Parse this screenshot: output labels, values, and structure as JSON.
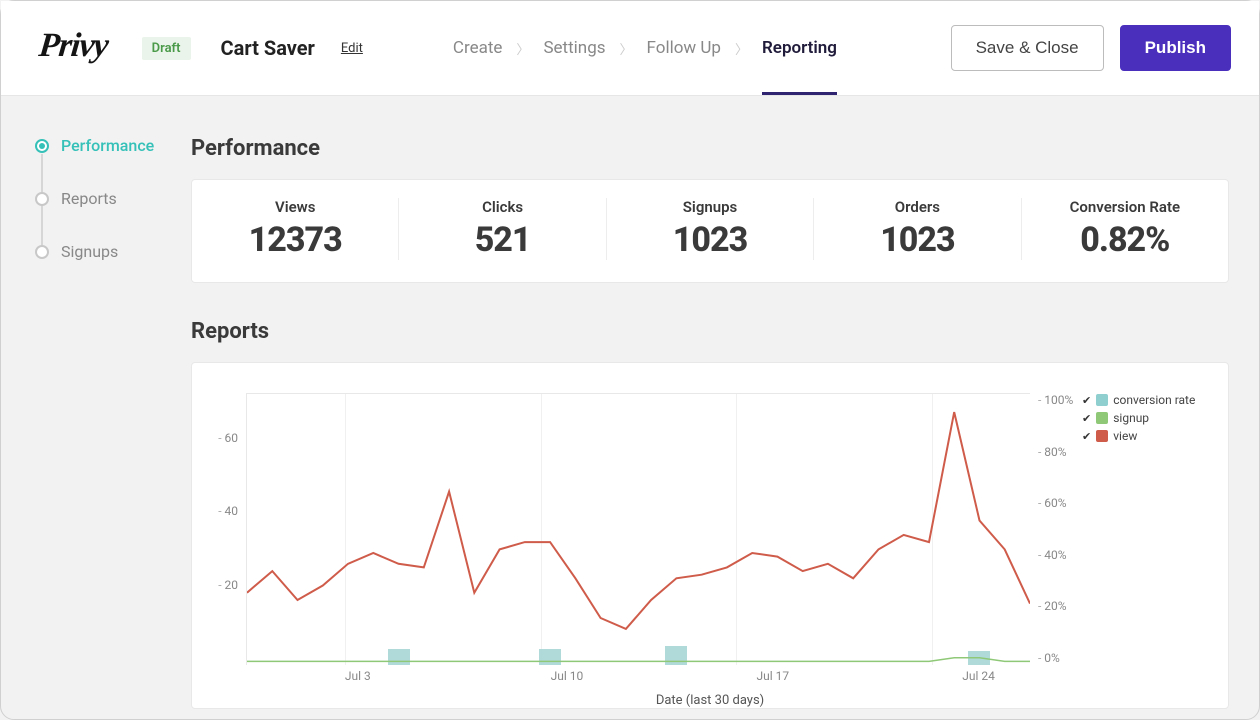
{
  "header": {
    "logo_text": "Privy",
    "status_badge": "Draft",
    "campaign_name": "Cart Saver",
    "edit_label": "Edit",
    "nav": [
      "Create",
      "Settings",
      "Follow Up",
      "Reporting"
    ],
    "active_nav_index": 3,
    "save_close_label": "Save & Close",
    "publish_label": "Publish"
  },
  "sidebar": {
    "items": [
      "Performance",
      "Reports",
      "Signups"
    ],
    "active_index": 0
  },
  "sections": {
    "performance_title": "Performance",
    "reports_title": "Reports"
  },
  "stats": [
    {
      "label": "Views",
      "value": "12373"
    },
    {
      "label": "Clicks",
      "value": "521"
    },
    {
      "label": "Signups",
      "value": "1023"
    },
    {
      "label": "Orders",
      "value": "1023"
    },
    {
      "label": "Conversion Rate",
      "value": "0.82%"
    }
  ],
  "chart_data": {
    "type": "line",
    "xlabel": "Date (last 30 days)",
    "x_ticks": [
      "",
      "Jul 3",
      "",
      "Jul 10",
      "",
      "Jul 17",
      "",
      "Jul 24",
      ""
    ],
    "y_left": {
      "label": "",
      "ticks": [
        "60",
        "40",
        "20"
      ]
    },
    "y_right": {
      "label": "",
      "ticks": [
        "100%",
        "80%",
        "60%",
        "40%",
        "20%",
        "0%"
      ]
    },
    "legend": [
      {
        "name": "conversion rate",
        "color": "#8fcfd0"
      },
      {
        "name": "signup",
        "color": "#8fc978"
      },
      {
        "name": "view",
        "color": "#cf5b4a"
      }
    ],
    "series": [
      {
        "name": "view",
        "axis": "left",
        "values": [
          20,
          26,
          18,
          22,
          28,
          31,
          28,
          27,
          48,
          20,
          32,
          34,
          34,
          24,
          13,
          10,
          18,
          24,
          25,
          27,
          31,
          30,
          26,
          28,
          24,
          32,
          36,
          34,
          70,
          40,
          32,
          17
        ]
      },
      {
        "name": "signup",
        "axis": "left",
        "values": [
          1,
          1,
          1,
          1,
          1,
          1,
          1,
          1,
          1,
          1,
          1,
          1,
          1,
          1,
          1,
          1,
          1,
          1,
          1,
          1,
          1,
          1,
          1,
          1,
          1,
          1,
          1,
          1,
          2,
          2,
          1,
          1
        ]
      },
      {
        "name": "conversion rate",
        "axis": "right",
        "bars": [
          {
            "x_index": 6,
            "value_pct": 6
          },
          {
            "x_index": 12,
            "value_pct": 6
          },
          {
            "x_index": 17,
            "value_pct": 7
          },
          {
            "x_index": 29,
            "value_pct": 5
          }
        ]
      }
    ]
  }
}
